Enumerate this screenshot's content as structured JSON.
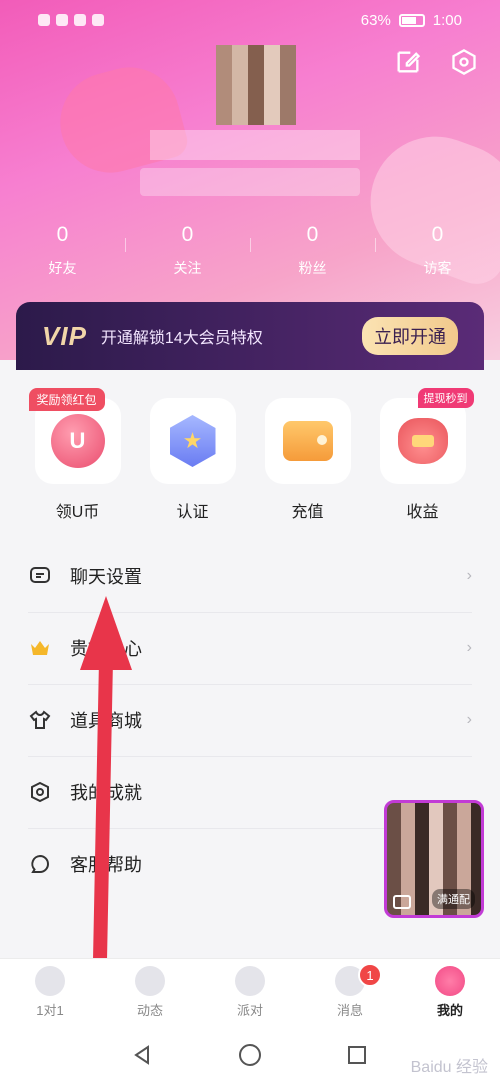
{
  "status_bar": {
    "battery": "63%",
    "time": "1:00"
  },
  "stats": [
    {
      "value": "0",
      "label": "好友"
    },
    {
      "value": "0",
      "label": "关注"
    },
    {
      "value": "0",
      "label": "粉丝"
    },
    {
      "value": "0",
      "label": "访客"
    }
  ],
  "vip": {
    "logo": "VIP",
    "text": "开通解锁14大会员特权",
    "button": "立即开通"
  },
  "features": [
    {
      "label": "领U币",
      "tag": "奖励领红包",
      "icon": "u-coin-icon"
    },
    {
      "label": "认证",
      "icon": "medal-icon"
    },
    {
      "label": "充值",
      "icon": "wallet-icon"
    },
    {
      "label": "收益",
      "tag": "提现秒到",
      "icon": "money-bag-icon"
    }
  ],
  "menu": [
    {
      "label": "聊天设置",
      "icon": "chat-icon",
      "chevron": "›"
    },
    {
      "label": "贵族中心",
      "icon": "crown-icon",
      "chevron": "›"
    },
    {
      "label": "道具商城",
      "icon": "shirt-icon",
      "chevron": "›"
    },
    {
      "label": "我的成就",
      "icon": "achievement-icon"
    },
    {
      "label": "客服帮助",
      "icon": "support-icon"
    }
  ],
  "float_video": {
    "button": "满通配"
  },
  "tabs": [
    {
      "label": "1对1"
    },
    {
      "label": "动态"
    },
    {
      "label": "派对"
    },
    {
      "label": "消息",
      "badge": "1"
    },
    {
      "label": "我的"
    }
  ],
  "watermark": "Baidu 经验",
  "colors": {
    "accent": "#f24a86",
    "vip_bg": "#2c1a4a",
    "arrow": "#e8354a"
  }
}
